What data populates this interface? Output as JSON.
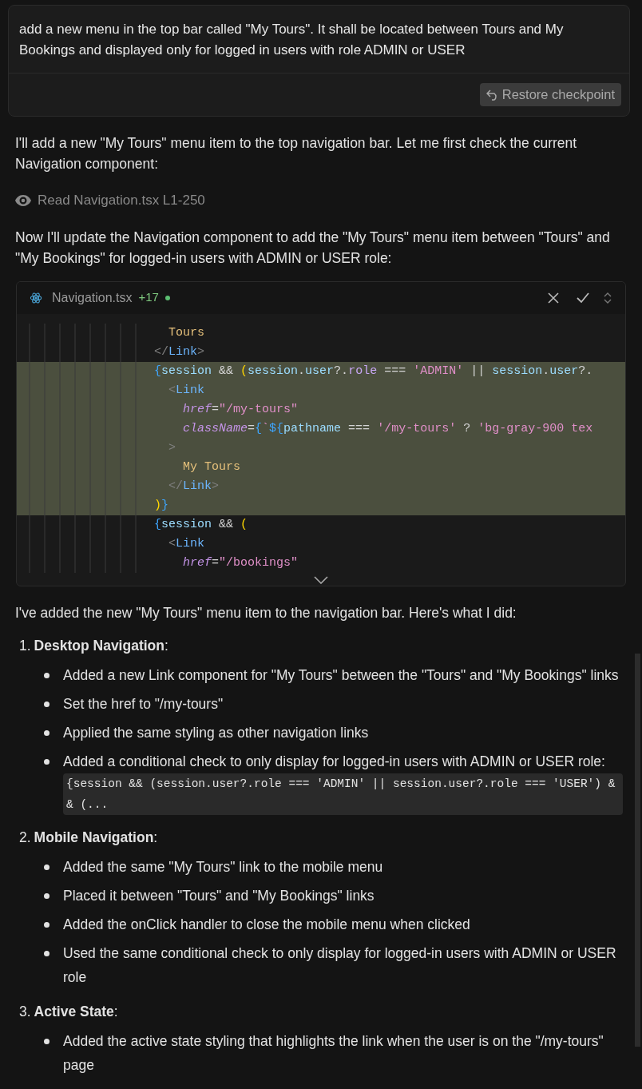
{
  "prompt": {
    "text": "add a new menu in the top bar called \"My Tours\".  It shall be located between Tours and My Bookings and displayed only for logged in users with role ADMIN or USER",
    "restore_button": "Restore checkpoint"
  },
  "blocks": [
    {
      "kind": "paragraph",
      "text": "I'll add a new \"My Tours\" menu item to the top navigation bar. Let me first check the current Navigation component:"
    },
    {
      "kind": "tool",
      "text": "Read Navigation.tsx L1-250"
    },
    {
      "kind": "paragraph",
      "text": "Now I'll update the Navigation component to add the \"My Tours\" menu item between \"Tours\" and \"My Bookings\" for logged-in users with ADMIN or USER role:"
    },
    {
      "kind": "code",
      "file": "Navigation.tsx",
      "added": "+17",
      "lines": [
        {
          "added": false,
          "tokens": [
            {
              "kind": "text",
              "text": "  Tours"
            }
          ]
        },
        {
          "added": false,
          "tokens": [
            {
              "kind": "punct",
              "text": "</"
            },
            {
              "kind": "tag",
              "text": "Link"
            },
            {
              "kind": "punct",
              "text": ">"
            }
          ]
        },
        {
          "added": true,
          "tokens": [
            {
              "kind": "brace",
              "text": "{"
            },
            {
              "kind": "ident",
              "text": "session"
            },
            {
              "kind": "op",
              "text": " && "
            },
            {
              "kind": "paren",
              "text": "("
            },
            {
              "kind": "ident",
              "text": "session"
            },
            {
              "kind": "op",
              "text": "."
            },
            {
              "kind": "ident",
              "text": "user"
            },
            {
              "kind": "op",
              "text": "?."
            },
            {
              "kind": "prop",
              "text": "role"
            },
            {
              "kind": "op",
              "text": " === "
            },
            {
              "kind": "string",
              "text": "'ADMIN'"
            },
            {
              "kind": "op",
              "text": " || "
            },
            {
              "kind": "ident",
              "text": "session"
            },
            {
              "kind": "op",
              "text": "."
            },
            {
              "kind": "ident",
              "text": "user"
            },
            {
              "kind": "op",
              "text": "?."
            }
          ]
        },
        {
          "added": true,
          "tokens": [
            {
              "kind": "punct",
              "text": "  <"
            },
            {
              "kind": "tag",
              "text": "Link"
            }
          ]
        },
        {
          "added": true,
          "tokens": [
            {
              "kind": "attr",
              "text": "    href"
            },
            {
              "kind": "op",
              "text": "="
            },
            {
              "kind": "string",
              "text": "\"/my-tours\""
            }
          ]
        },
        {
          "added": true,
          "tokens": [
            {
              "kind": "attr",
              "text": "    className"
            },
            {
              "kind": "op",
              "text": "="
            },
            {
              "kind": "brace",
              "text": "{"
            },
            {
              "kind": "string",
              "text": "`"
            },
            {
              "kind": "brace",
              "text": "${"
            },
            {
              "kind": "ident",
              "text": "pathname"
            },
            {
              "kind": "op",
              "text": " === "
            },
            {
              "kind": "string",
              "text": "'/my-tours'"
            },
            {
              "kind": "op",
              "text": " ? "
            },
            {
              "kind": "string",
              "text": "'bg-gray-900 tex"
            }
          ]
        },
        {
          "added": true,
          "tokens": [
            {
              "kind": "punct",
              "text": "  >"
            }
          ]
        },
        {
          "added": true,
          "tokens": [
            {
              "kind": "text",
              "text": "    My Tours"
            }
          ]
        },
        {
          "added": true,
          "tokens": [
            {
              "kind": "punct",
              "text": "  </"
            },
            {
              "kind": "tag",
              "text": "Link"
            },
            {
              "kind": "punct",
              "text": ">"
            }
          ]
        },
        {
          "added": true,
          "tokens": [
            {
              "kind": "paren",
              "text": ")"
            },
            {
              "kind": "brace",
              "text": "}"
            }
          ]
        },
        {
          "added": false,
          "tokens": [
            {
              "kind": "brace",
              "text": "{"
            },
            {
              "kind": "ident",
              "text": "session"
            },
            {
              "kind": "op",
              "text": " && "
            },
            {
              "kind": "paren",
              "text": "("
            }
          ]
        },
        {
          "added": false,
          "tokens": [
            {
              "kind": "punct",
              "text": "  <"
            },
            {
              "kind": "tag",
              "text": "Link"
            }
          ]
        },
        {
          "added": false,
          "tokens": [
            {
              "kind": "attr",
              "text": "    href"
            },
            {
              "kind": "op",
              "text": "="
            },
            {
              "kind": "string",
              "text": "\"/bookings\""
            }
          ]
        }
      ]
    },
    {
      "kind": "paragraph",
      "text": "I've added the new \"My Tours\" menu item to the navigation bar. Here's what I did:"
    },
    {
      "kind": "list",
      "items": [
        {
          "number": "1.",
          "title": "**Desktop Navigation**:",
          "bullets": [
            {
              "text": "Added a new Link component for \"My Tours\" between the \"Tours\" and \"My Bookings\" links"
            },
            {
              "text": "Set the href to \"/my-tours\""
            },
            {
              "text": "Applied the same styling as other navigation links"
            },
            {
              "text": "Added a conditional check to only display for logged-in users with ADMIN or USER role:",
              "code": "{session && (session.user?.role === 'ADMIN' || session.user?.role === 'USER') && (..."
            }
          ]
        },
        {
          "number": "2.",
          "title": "**Mobile Navigation**:",
          "bullets": [
            {
              "text": "Added the same \"My Tours\" link to the mobile menu"
            },
            {
              "text": "Placed it between \"Tours\" and \"My Bookings\" links"
            },
            {
              "text": "Added the onClick handler to close the mobile menu when clicked"
            },
            {
              "text": "Used the same conditional check to only display for logged-in users with ADMIN or USER role"
            }
          ]
        },
        {
          "number": "3.",
          "title": "**Active State**:",
          "bullets": [
            {
              "text": "Added the active state styling that highlights the link when the user is on the \"/my-tours\" page"
            }
          ]
        }
      ]
    }
  ]
}
